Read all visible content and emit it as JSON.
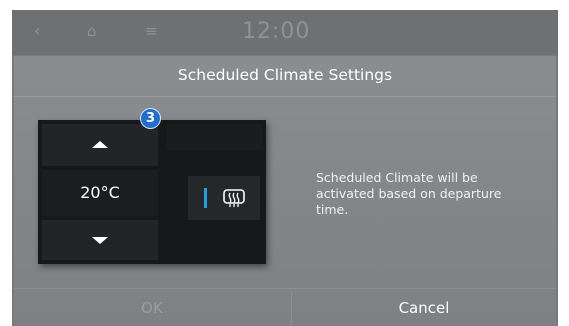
{
  "status_bar": {
    "time": "12:00",
    "icons": {
      "back": "back-chevron-icon",
      "home": "home-icon",
      "menu": "menu-icon"
    }
  },
  "dialog": {
    "title": "Scheduled Climate Settings",
    "temperature": "20°C",
    "callout_number": "3",
    "defrost_icon": "rear-defrost-icon",
    "info_text": "Scheduled Climate will be activated based on departure time.",
    "ok_label": "OK",
    "cancel_label": "Cancel"
  },
  "colors": {
    "accent_blue": "#1aa3e8",
    "badge_blue": "#1f6fd0",
    "panel_dark": "#16181a",
    "dialog_bg": "#8a8c90"
  }
}
